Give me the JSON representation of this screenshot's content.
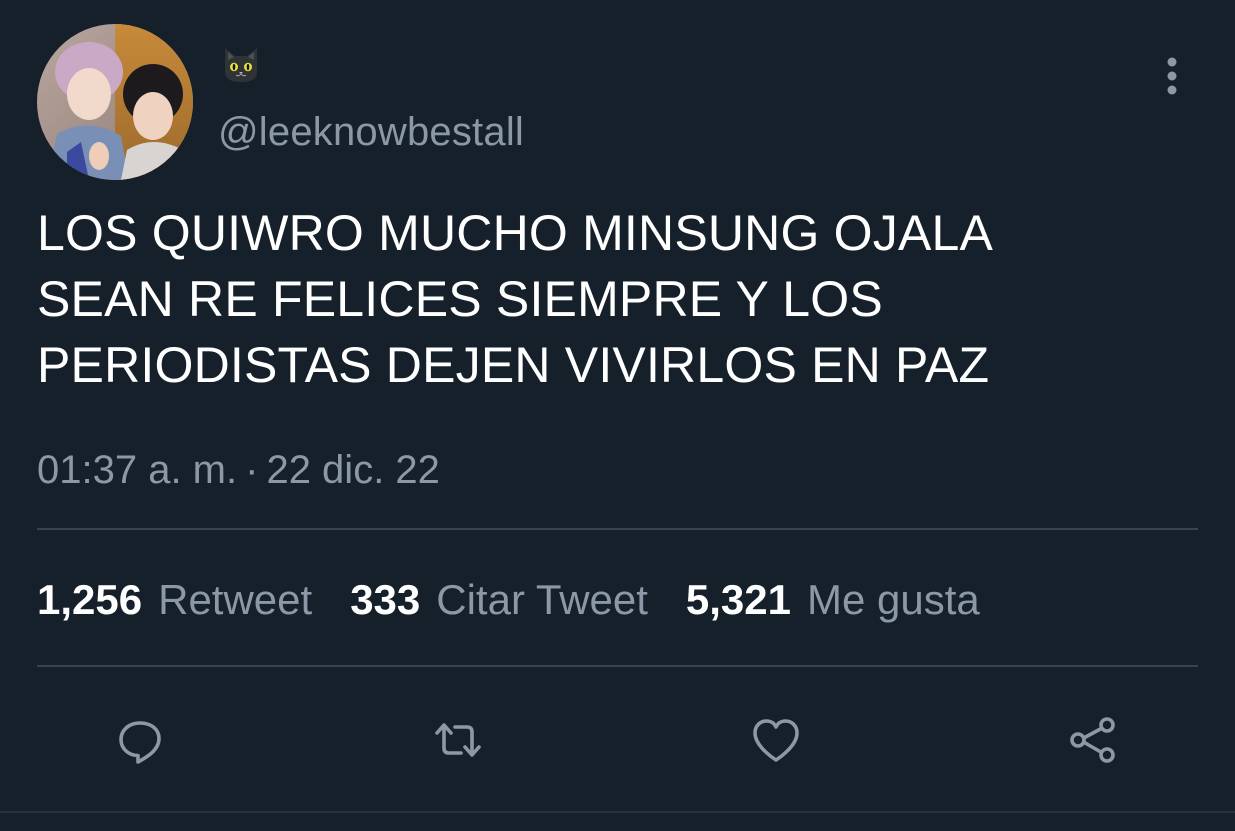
{
  "tweet": {
    "display_name_icon": "black-cat-emoji",
    "handle": "@leeknowbestall",
    "text": "LOS QUIWRO MUCHO MINSUNG OJALA\nSEAN RE FELICES SIEMPRE Y LOS\nPERIODISTAS DEJEN VIVIRLOS EN PAZ",
    "time": "01:37 a. m.",
    "separator": "·",
    "date": "22 dic. 22"
  },
  "stats": {
    "retweets_count": "1,256",
    "retweets_label": "Retweet",
    "quotes_count": "333",
    "quotes_label": "Citar Tweet",
    "likes_count": "5,321",
    "likes_label": "Me gusta"
  },
  "actions": {
    "icons": [
      "reply-icon",
      "retweet-icon",
      "like-icon",
      "share-icon"
    ]
  },
  "colors": {
    "background": "#15202b",
    "text_primary": "#ffffff",
    "text_secondary": "#8b98a5",
    "divider": "#38444d",
    "icon": "#8b98a5"
  }
}
